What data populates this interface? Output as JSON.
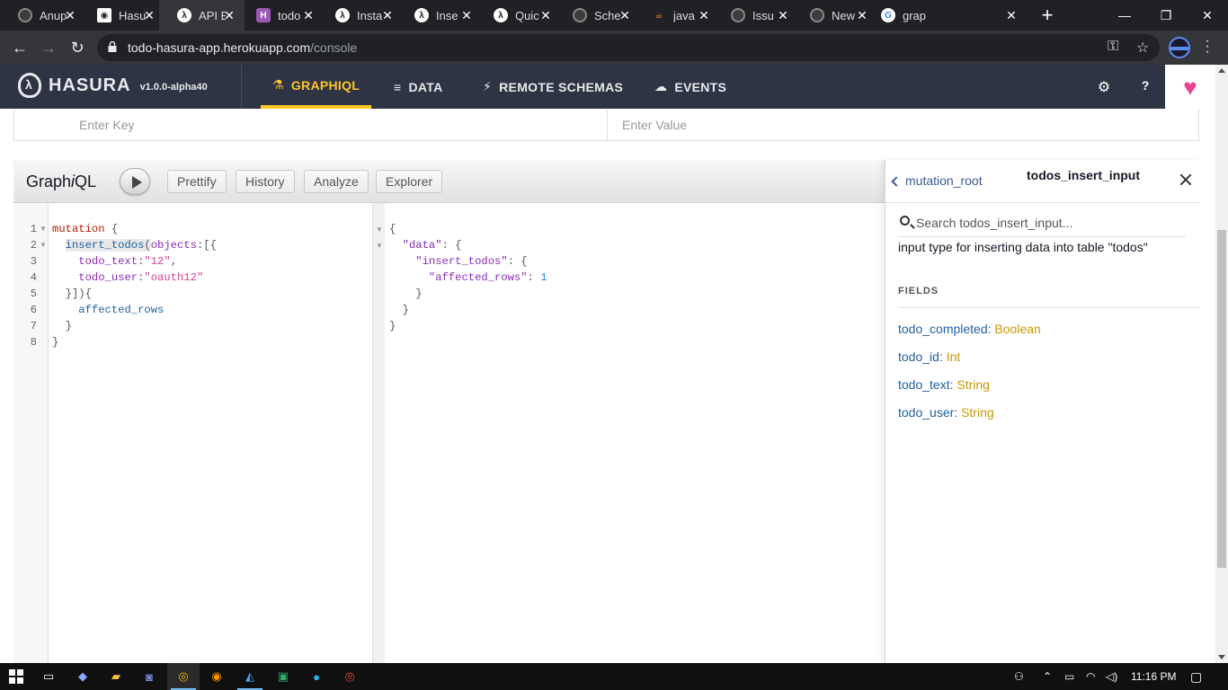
{
  "browser": {
    "tabs": [
      {
        "title": "Anup",
        "icon": "github-icon"
      },
      {
        "title": "Hasu",
        "icon": "hasura-shield-icon"
      },
      {
        "title": "API E",
        "icon": "hasura-icon",
        "active": true
      },
      {
        "title": "todo",
        "icon": "h-icon"
      },
      {
        "title": "Insta",
        "icon": "hasura-icon"
      },
      {
        "title": "Inse",
        "icon": "hasura-icon"
      },
      {
        "title": "Quic",
        "icon": "hasura-icon"
      },
      {
        "title": "Sche",
        "icon": "github-icon"
      },
      {
        "title": "java",
        "icon": "stackoverflow-icon"
      },
      {
        "title": "Issu",
        "icon": "github-icon"
      },
      {
        "title": "New",
        "icon": "github-icon"
      },
      {
        "title": "grap",
        "icon": "google-icon"
      }
    ],
    "url_host": "todo-hasura-app.herokuapp.com",
    "url_path": "/console"
  },
  "hasura": {
    "logo_text": "HASURA",
    "version": "v1.0.0-alpha40",
    "nav": [
      {
        "label": "GRAPHIQL",
        "icon": "flask-icon",
        "active": true
      },
      {
        "label": "DATA",
        "icon": "database-icon"
      },
      {
        "label": "REMOTE SCHEMAS",
        "icon": "plug-icon"
      },
      {
        "label": "EVENTS",
        "icon": "cloud-icon"
      }
    ],
    "settings_icon": "gear-icon",
    "help_label": "?"
  },
  "headers_row": {
    "key_placeholder": "Enter Key",
    "value_placeholder": "Enter Value"
  },
  "graphiql": {
    "title_pre": "Graph",
    "title_i": "i",
    "title_post": "QL",
    "buttons": [
      "Prettify",
      "History",
      "Analyze",
      "Explorer"
    ],
    "line_numbers": [
      "1",
      "2",
      "3",
      "4",
      "5",
      "6",
      "7",
      "8"
    ],
    "query": {
      "l1_kw": "mutation",
      "l1_brace": " {",
      "l2_fn": "insert_todos",
      "l2_paren": "(",
      "l2_arg": "objects",
      "l2_rest": ":[{",
      "l3_arg": "todo_text",
      "l3_colon": ":",
      "l3_str": "\"12\"",
      "l3_comma": ",",
      "l4_arg": "todo_user",
      "l4_colon": ":",
      "l4_str": "\"oauth12\"",
      "l5": "}]){",
      "l6": "affected_rows",
      "l7": "}",
      "l8": "}"
    },
    "result": {
      "r1": "{",
      "r2_key": "\"data\"",
      "r2_rest": ": {",
      "r3_key": "\"insert_todos\"",
      "r3_rest": ": {",
      "r4_key": "\"affected_rows\"",
      "r4_colon": ": ",
      "r4_val": "1",
      "r5": "}",
      "r6": "}",
      "r7": "}"
    }
  },
  "docs": {
    "back_label": "mutation_root",
    "title": "todos_insert_input",
    "search_placeholder": "Search todos_insert_input...",
    "description": "input type for inserting data into table \"todos\"",
    "fields_heading": "FIELDS",
    "fields": [
      {
        "name": "todo_completed",
        "type": "Boolean"
      },
      {
        "name": "todo_id",
        "type": "Int"
      },
      {
        "name": "todo_text",
        "type": "String"
      },
      {
        "name": "todo_user",
        "type": "String"
      }
    ]
  },
  "taskbar": {
    "time": "11:16 PM"
  }
}
